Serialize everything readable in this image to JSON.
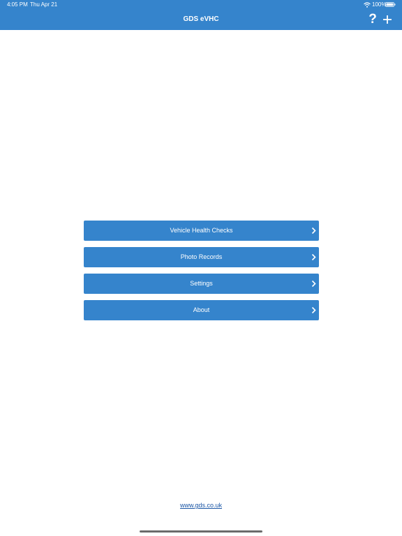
{
  "status_bar": {
    "time": "4:05 PM",
    "date": "Thu Apr 21",
    "battery": "100%",
    "wifi_icon": "wifi-icon",
    "battery_icon": "battery-icon"
  },
  "nav": {
    "title": "GDS eVHC",
    "help_icon": "?",
    "add_icon": "plus-icon"
  },
  "colors": {
    "accent": "#3584cc",
    "link": "#1a56a6"
  },
  "menu": {
    "items": [
      {
        "label": "Vehicle Health Checks",
        "icon": "chevron-right-icon"
      },
      {
        "label": "Photo Records",
        "icon": "chevron-right-icon"
      },
      {
        "label": "Settings",
        "icon": "chevron-right-icon"
      },
      {
        "label": "About",
        "icon": "chevron-right-icon"
      }
    ]
  },
  "footer": {
    "link_text": "www.gds.co.uk"
  }
}
